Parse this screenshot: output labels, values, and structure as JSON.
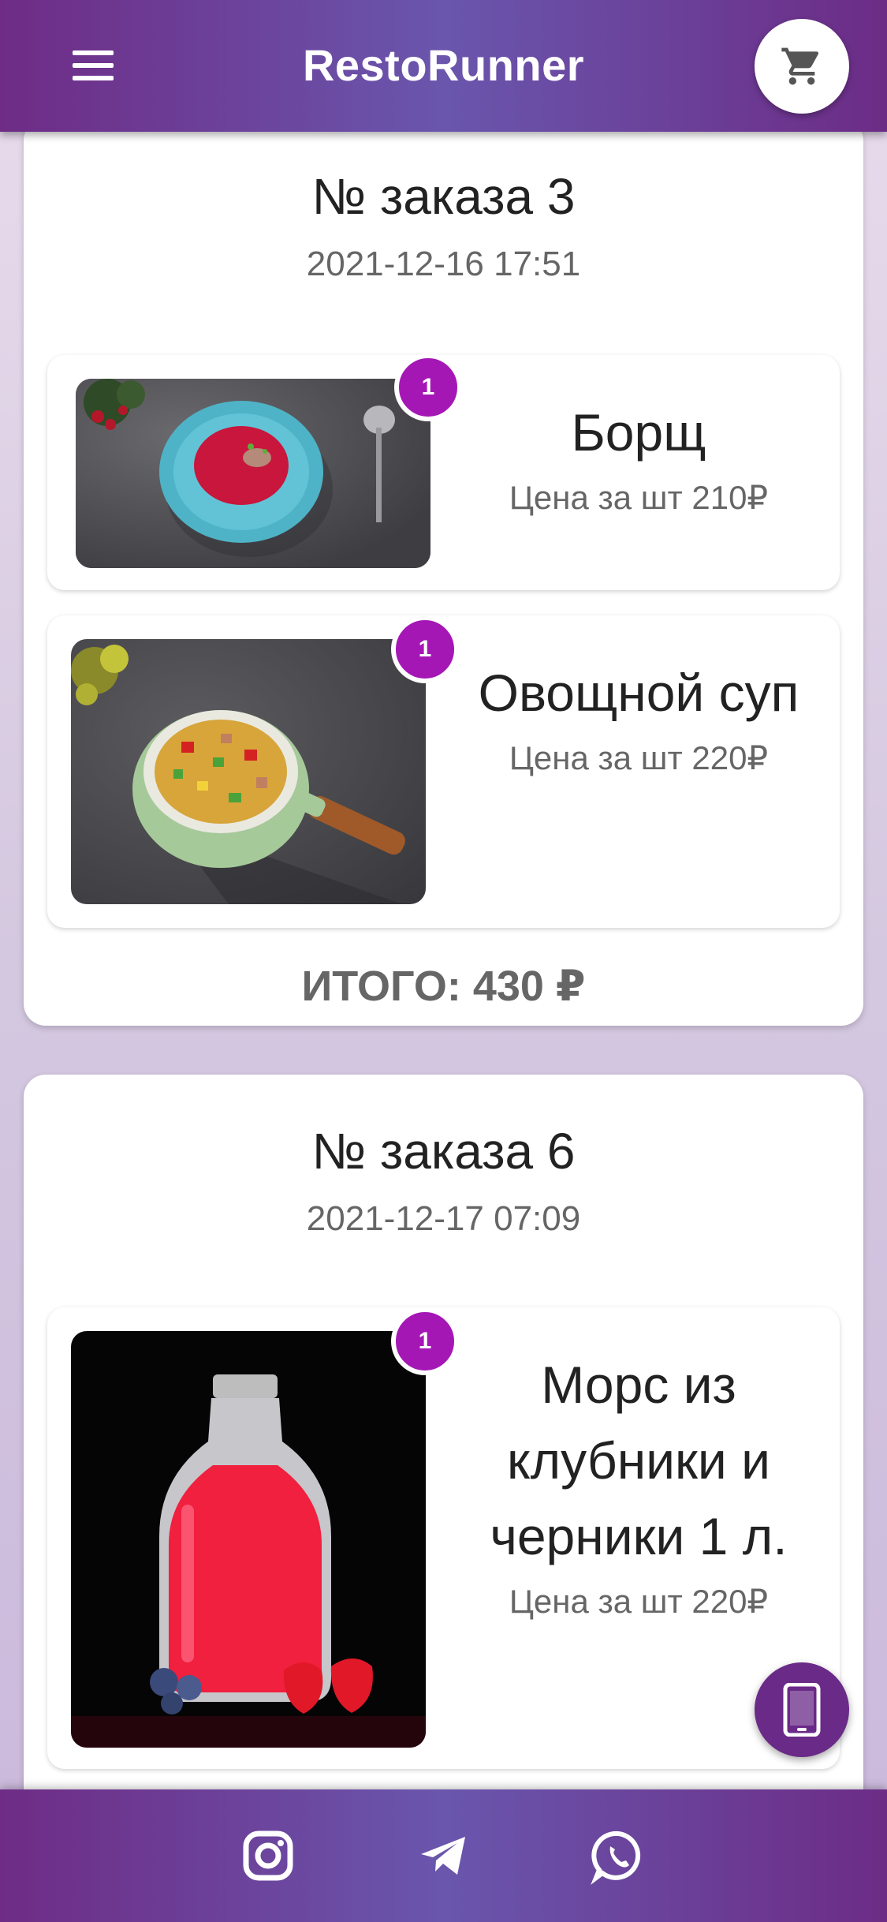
{
  "header": {
    "title": "RestoRunner",
    "menu_icon": "hamburger-menu-icon",
    "cart_icon": "shopping-cart-icon"
  },
  "orders": [
    {
      "title": "№ заказа 3",
      "date": "2021-12-16 17:51",
      "items": [
        {
          "name": "Борщ",
          "price": "Цена за шт 210₽",
          "quantity": "1",
          "image": "borscht-photo"
        },
        {
          "name": "Овощной суп",
          "price": "Цена за шт 220₽",
          "quantity": "1",
          "image": "vegetable-soup-photo"
        }
      ],
      "total": "ИТОГО: 430 ₽"
    },
    {
      "title": "№ заказа 6",
      "date": "2021-12-17 07:09",
      "items": [
        {
          "name": "Морс из клубники и черники 1 л.",
          "price": "Цена за шт 220₽",
          "quantity": "1",
          "image": "berry-drink-bottle-photo"
        }
      ]
    }
  ],
  "footer": {
    "icons": [
      "instagram-icon",
      "telegram-icon",
      "whatsapp-icon"
    ]
  },
  "fab": {
    "icon": "phone-icon"
  },
  "colors": {
    "primary": "#6e2c86",
    "accent": "#a517b5",
    "header_mid": "#6a56ad"
  }
}
